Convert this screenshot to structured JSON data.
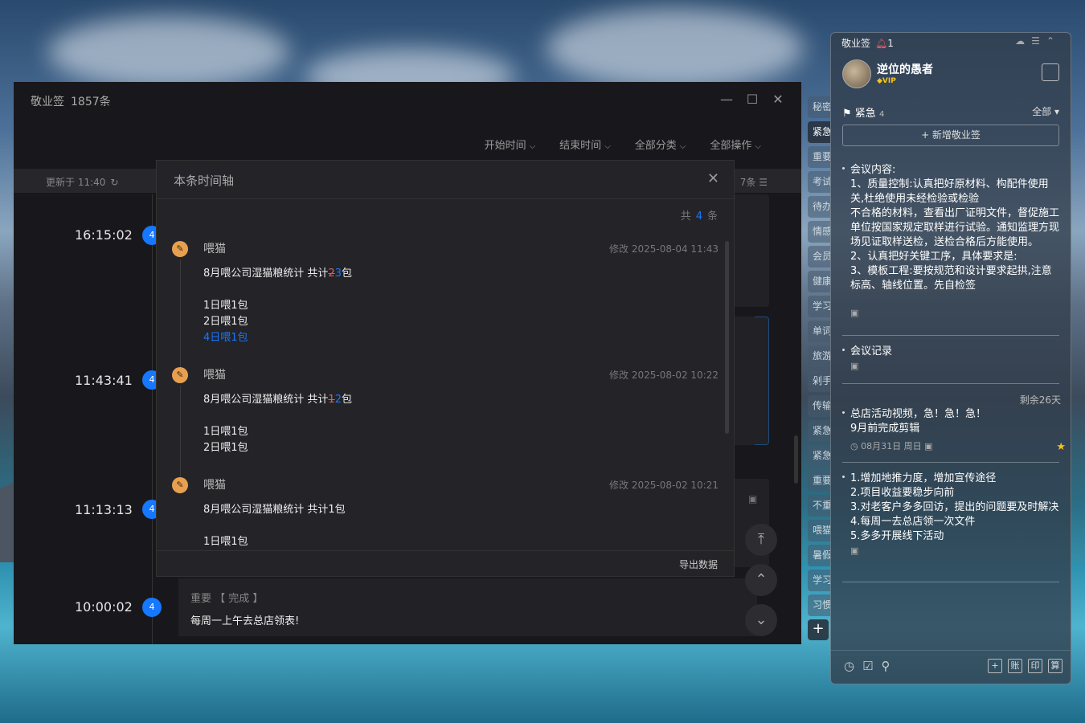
{
  "main": {
    "app_name": "敬业签",
    "count_text": "1857条",
    "filters": [
      "开始时间",
      "结束时间",
      "全部分类",
      "全部操作"
    ],
    "updated_text": "更新于 11:40",
    "right_count": "7条",
    "timeline": [
      {
        "time": "16:15:02",
        "badge": "4"
      },
      {
        "time": "11:43:41",
        "badge": "4"
      },
      {
        "time": "11:13:13",
        "badge": "4"
      },
      {
        "time": "10:00:02",
        "badge": "4"
      }
    ],
    "bottom_card": {
      "tag": "重要 【 完成 】",
      "text": "每周一上午去总店领表!"
    }
  },
  "dialog": {
    "title": "本条时间轴",
    "count_prefix": "共",
    "count": "4",
    "count_suffix": "条",
    "export": "导出数据",
    "entries": [
      {
        "author": "喂猫",
        "date": "修改 2025-08-04 11:43",
        "line_prefix": "8月喂公司湿猫粮统计 共计",
        "old_num": "2",
        "new_num": "3",
        "line_suffix": "包",
        "lines": [
          "1日喂1包",
          "2日喂1包"
        ],
        "added_line": "4日喂1包"
      },
      {
        "author": "喂猫",
        "date": "修改 2025-08-02 10:22",
        "line_prefix": "8月喂公司湿猫粮统计 共计",
        "old_num": "1",
        "new_num": "2",
        "line_suffix": "包",
        "lines": [
          "1日喂1包",
          "2日喂1包"
        ]
      },
      {
        "author": "喂猫",
        "date": "修改 2025-08-02 10:21",
        "line_full": "8月喂公司湿猫粮统计 共计1包",
        "lines": [
          "1日喂1包"
        ]
      }
    ]
  },
  "side_tabs": [
    "秘密",
    "紧急",
    "重要",
    "考试",
    "待办",
    "情感",
    "会员",
    "健康",
    "学习",
    "单词",
    "旅游",
    "剁手",
    "传输",
    "紧急",
    "紧急",
    "重要",
    "不重",
    "喂猫",
    "暑假",
    "学习",
    "习惯"
  ],
  "widget": {
    "app_name": "敬业签",
    "notif_count": "1",
    "user": "逆位的愚者",
    "vip": "VIP",
    "category": "紧急",
    "category_count": "4",
    "filter": "全部",
    "new_note": "+ 新增敬业签",
    "notes": [
      {
        "text": "会议内容:\n1、质量控制:认真把好原材料、构配件使用关,杜绝使用未经检验或检验\n不合格的材料，查看出厂证明文件，督促施工单位按国家规定取样进行试验。通知监理方现场见证取样送检，送检合格后方能使用。\n2、认真把好关键工序，具体要求是:\n3、模板工程:要按规范和设计要求起拱,注意标高、轴线位置。先自检签"
      },
      {
        "text": "会议记录"
      },
      {
        "remain": "剩余26天",
        "text": "总店活动视频，急！急！急！\n9月前完成剪辑",
        "meta": "08月31日 周日"
      },
      {
        "text": "1.增加地推力度，增加宣传途径\n2.项目收益要稳步向前\n3.对老客户多多回访，提出的问题要及时解决\n4.每周一去总店领一次文件\n5.多多开展线下活动"
      }
    ],
    "footer_right": [
      "+",
      "账",
      "印",
      "算"
    ]
  },
  "colors": {
    "accent": "#1677ff",
    "edit_icon": "#e8a050",
    "deleted": "#e06050",
    "star": "#f5c518"
  }
}
